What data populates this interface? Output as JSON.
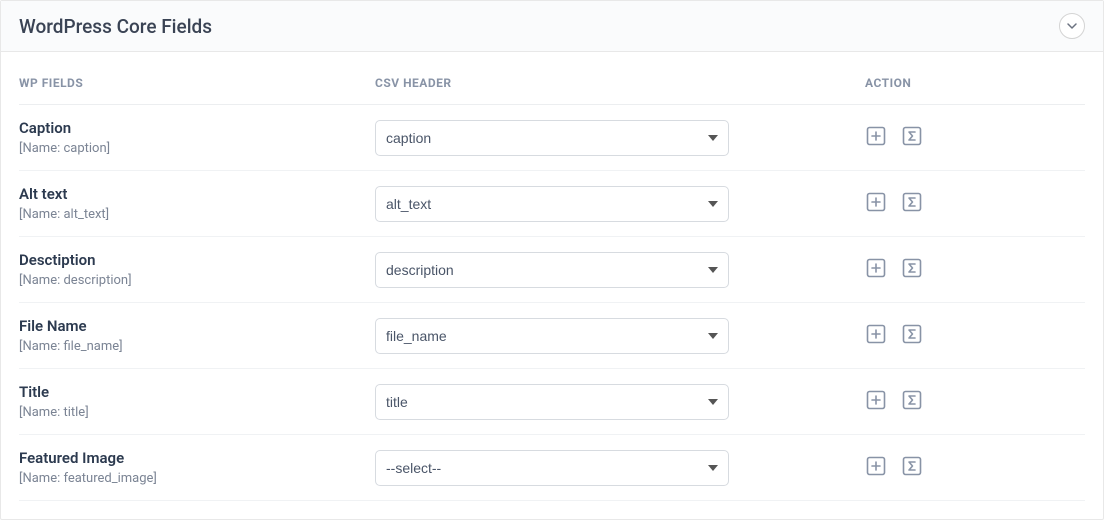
{
  "panel": {
    "title": "WordPress Core Fields"
  },
  "headers": {
    "wp_fields": "WP FIELDS",
    "csv_header": "CSV HEADER",
    "action": "ACTION"
  },
  "name_prefix": "[Name: ",
  "name_suffix": "]",
  "rows": [
    {
      "label": "Caption",
      "name": "caption",
      "selected": "caption"
    },
    {
      "label": "Alt text",
      "name": "alt_text",
      "selected": "alt_text"
    },
    {
      "label": "Desctiption",
      "name": "description",
      "selected": "description"
    },
    {
      "label": "File Name",
      "name": "file_name",
      "selected": "file_name"
    },
    {
      "label": "Title",
      "name": "title",
      "selected": "title"
    },
    {
      "label": "Featured Image",
      "name": "featured_image",
      "selected": "--select--"
    }
  ],
  "select_placeholder": "--select--",
  "csv_options": [
    "--select--",
    "caption",
    "alt_text",
    "description",
    "file_name",
    "title"
  ]
}
